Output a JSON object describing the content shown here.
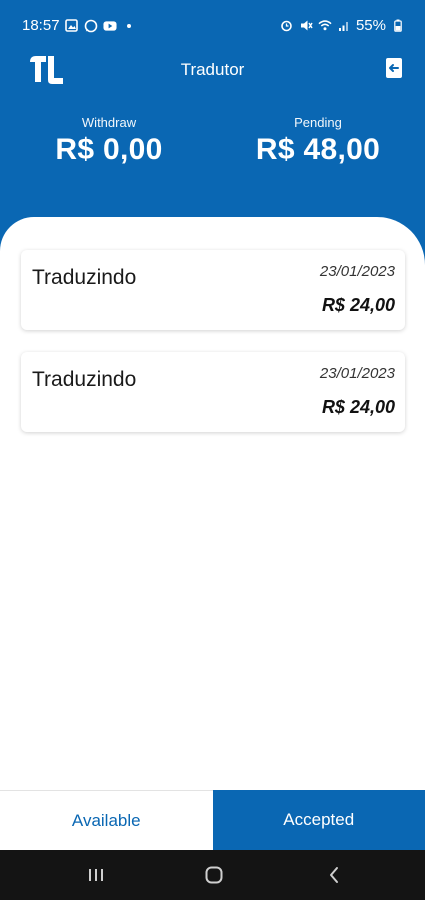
{
  "status_bar": {
    "time": "18:57",
    "battery": "55%"
  },
  "header": {
    "title": "Tradutor"
  },
  "balances": {
    "withdraw": {
      "label": "Withdraw",
      "value": "R$ 0,00"
    },
    "pending": {
      "label": "Pending",
      "value": "R$ 48,00"
    }
  },
  "items": [
    {
      "status": "Traduzindo",
      "date": "23/01/2023",
      "amount": "R$ 24,00"
    },
    {
      "status": "Traduzindo",
      "date": "23/01/2023",
      "amount": "R$ 24,00"
    }
  ],
  "tabs": {
    "available": "Available",
    "accepted": "Accepted",
    "active": "accepted"
  },
  "colors": {
    "primary": "#0a67b3",
    "background": "#ffffff",
    "nav_bar": "#141414"
  },
  "icons": {
    "logo": "app-logo",
    "logout": "logout-icon",
    "nav_recents": "recents-icon",
    "nav_home": "home-icon",
    "nav_back": "back-icon"
  }
}
